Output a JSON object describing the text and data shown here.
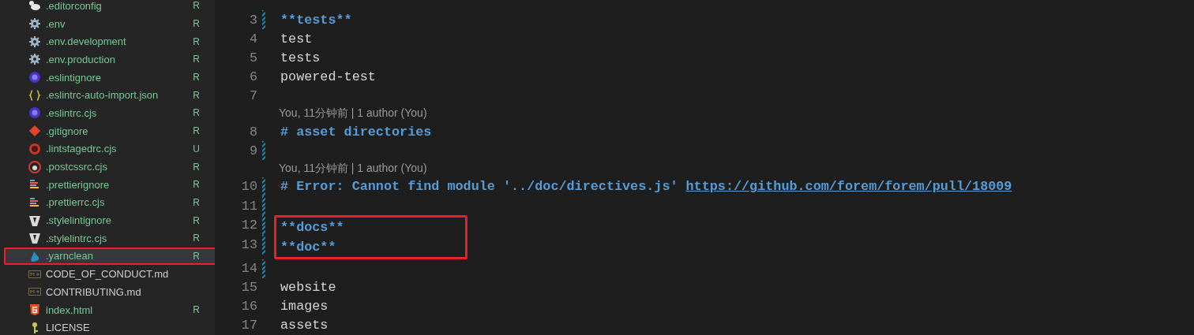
{
  "explorer": {
    "files": [
      {
        "name": ".editorconfig",
        "kind": "editorconfig",
        "status": "R",
        "selected": false,
        "boxed": false
      },
      {
        "name": ".env",
        "kind": "gear",
        "status": "R",
        "selected": false,
        "boxed": false
      },
      {
        "name": ".env.development",
        "kind": "gear",
        "status": "R",
        "selected": false,
        "boxed": false
      },
      {
        "name": ".env.production",
        "kind": "gear",
        "status": "R",
        "selected": false,
        "boxed": false
      },
      {
        "name": ".eslintignore",
        "kind": "eslint",
        "status": "R",
        "selected": false,
        "boxed": false
      },
      {
        "name": ".eslintrc-auto-import.json",
        "kind": "json",
        "status": "R",
        "selected": false,
        "boxed": false
      },
      {
        "name": ".eslintrc.cjs",
        "kind": "eslint",
        "status": "R",
        "selected": false,
        "boxed": false
      },
      {
        "name": ".gitignore",
        "kind": "git",
        "status": "R",
        "selected": false,
        "boxed": false
      },
      {
        "name": ".lintstagedrc.cjs",
        "kind": "lintstaged",
        "status": "U",
        "selected": false,
        "boxed": false
      },
      {
        "name": ".postcssrc.cjs",
        "kind": "postcss",
        "status": "R",
        "selected": false,
        "boxed": false
      },
      {
        "name": ".prettierignore",
        "kind": "prettier",
        "status": "R",
        "selected": false,
        "boxed": false
      },
      {
        "name": ".prettierrc.cjs",
        "kind": "prettier",
        "status": "R",
        "selected": false,
        "boxed": false
      },
      {
        "name": ".stylelintignore",
        "kind": "stylelint",
        "status": "R",
        "selected": false,
        "boxed": false
      },
      {
        "name": ".stylelintrc.cjs",
        "kind": "stylelint",
        "status": "R",
        "selected": false,
        "boxed": false
      },
      {
        "name": ".yarnclean",
        "kind": "yarn",
        "status": "R",
        "selected": true,
        "boxed": true
      },
      {
        "name": "CODE_OF_CONDUCT.md",
        "kind": "markdown",
        "selected": false,
        "boxed": false
      },
      {
        "name": "CONTRIBUTING.md",
        "kind": "markdown",
        "selected": false,
        "boxed": false
      },
      {
        "name": "index.html",
        "kind": "html",
        "status": "R",
        "selected": false,
        "boxed": false
      },
      {
        "name": "LICENSE",
        "kind": "license",
        "selected": false,
        "boxed": false
      }
    ]
  },
  "editor": {
    "lines": [
      {
        "number": "3",
        "text": "**tests**",
        "kind": "emphasis",
        "changed": true
      },
      {
        "number": "4",
        "text": "test",
        "kind": "plain",
        "changed": false
      },
      {
        "number": "5",
        "text": "tests",
        "kind": "plain",
        "changed": false
      },
      {
        "number": "6",
        "text": "powered-test",
        "kind": "plain",
        "changed": false
      },
      {
        "number": "7",
        "changed": false
      },
      {
        "number": "8",
        "text": "# asset directories",
        "kind": "comment",
        "changed": false,
        "blame": "You, 11分钟前 | 1 author (You)"
      },
      {
        "number": "9",
        "changed": true
      },
      {
        "number": "10",
        "text": "# Error: Cannot find module '../doc/directives.js'",
        "link": "https://github.com/forem/forem/pull/18009",
        "kind": "comment",
        "changed": true,
        "blame": "You, 11分钟前 | 1 author (You)"
      },
      {
        "number": "11",
        "changed": true
      },
      {
        "number": "12",
        "text": "**docs**",
        "kind": "emphasis",
        "changed": true,
        "boxed": true
      },
      {
        "number": "13",
        "text": "**doc**",
        "kind": "emphasis",
        "changed": true,
        "boxed": true
      },
      {
        "number": "14",
        "changed": true
      },
      {
        "number": "15",
        "text": "website",
        "kind": "plain",
        "changed": false
      },
      {
        "number": "16",
        "text": "images",
        "kind": "plain",
        "changed": false
      },
      {
        "number": "17",
        "text": "assets",
        "kind": "plain",
        "changed": false
      }
    ]
  }
}
